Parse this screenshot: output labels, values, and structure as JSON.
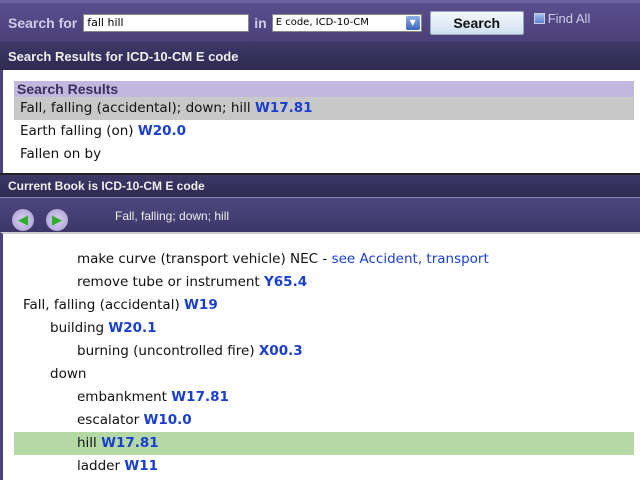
{
  "search": {
    "label": "Search for",
    "value": "fall hill",
    "in_label": "in",
    "book": "E code, ICD-10-CM",
    "button": "Search",
    "find_all": "Find All"
  },
  "results_header": "Search Results for ICD-10-CM E code",
  "results": {
    "title": "Search Results",
    "items": [
      {
        "text": "Fall, falling (accidental); down; hill",
        "code": "W17.81",
        "selected": true
      },
      {
        "text": "Earth falling (on)",
        "code": "W20.0",
        "selected": false
      },
      {
        "text": "Fallen on by",
        "code": "",
        "selected": false
      }
    ]
  },
  "book_header": "Current Book is ICD-10-CM E code",
  "nav": {
    "breadcrumb": "Fall, falling; down; hill",
    "back": "back-arrow-icon",
    "forward": "forward-arrow-icon"
  },
  "tree": [
    {
      "text": "make curve (transport vehicle) NEC -",
      "code": "",
      "link": "see Accident, transport",
      "level": 2
    },
    {
      "text": "remove tube or instrument",
      "code": "Y65.4",
      "link": "",
      "level": 2
    },
    {
      "text": "Fall, falling (accidental)",
      "code": "W19",
      "link": "",
      "level": 0
    },
    {
      "text": "building",
      "code": "W20.1",
      "link": "",
      "level": 1
    },
    {
      "text": "burning (uncontrolled fire)",
      "code": "X00.3",
      "link": "",
      "level": 2
    },
    {
      "text": "down",
      "code": "",
      "link": "",
      "level": 1
    },
    {
      "text": "embankment",
      "code": "W17.81",
      "link": "",
      "level": 2
    },
    {
      "text": "escalator",
      "code": "W10.0",
      "link": "",
      "level": 2
    },
    {
      "text": "hill",
      "code": "W17.81",
      "link": "",
      "level": 2,
      "highlight": true
    },
    {
      "text": "ladder",
      "code": "W11",
      "link": "",
      "level": 2
    }
  ],
  "colors": {
    "highlight": "#b5d9a5",
    "selected": "#c8c8c8",
    "code": "#1a3fd0"
  }
}
